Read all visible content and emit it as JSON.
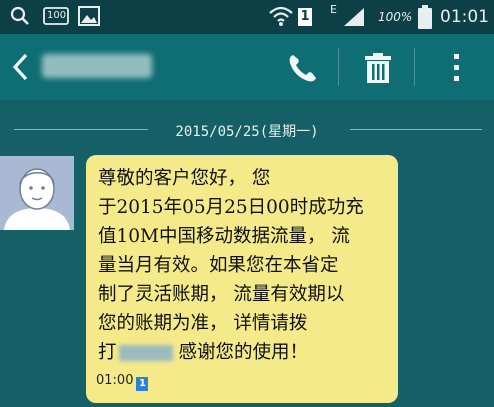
{
  "statusbar": {
    "battery_text": "100%",
    "data_indicator": "E",
    "sim_slot": "1",
    "clock": "01:01",
    "memo_icon_text": "100"
  },
  "appbar": {
    "contact_name": "10086"
  },
  "conversation": {
    "date_header": "2015/05/25(星期一)",
    "message": {
      "lines": [
        "尊敬的客户您好，  您",
        "于2015年05月25日00时成功充",
        "值10M中国移动数据流量，  流",
        "量当月有效。如果您在本省定",
        "制了灵活账期，  流量有效期以",
        "您的账期为准，  详情请拨"
      ],
      "last_line_prefix": "打",
      "hidden_number": "10086",
      "last_line_suffix": "感谢您的使用！",
      "time": "01:00",
      "sim_slot": "1"
    }
  },
  "colors": {
    "background": "#155f66",
    "appbar": "#0f6e74",
    "statusbar": "#0c4046",
    "bubble": "#f4ea8a",
    "avatar_bg": "#aab9d3"
  },
  "icons": [
    "search-icon",
    "memo-icon",
    "image-icon",
    "wifi-icon",
    "sim-icon",
    "signal-icon",
    "battery-icon",
    "back-icon",
    "phone-icon",
    "trash-icon",
    "more-icon",
    "avatar-icon"
  ]
}
